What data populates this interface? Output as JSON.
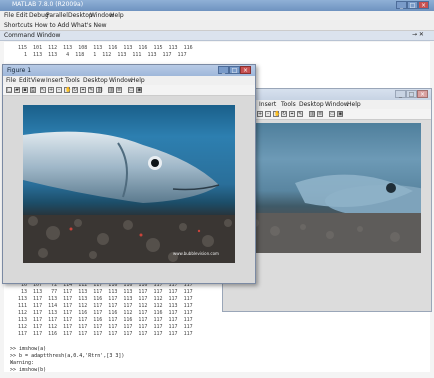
{
  "main": {
    "title": "MATLAB 7.8.0 (R2009a)",
    "menus": [
      "File",
      "Edit",
      "Debug",
      "Parallel",
      "Desktop",
      "Window",
      "Help"
    ],
    "shortcuts": "Shortcuts  How to Add  What's New",
    "command_window_label": "Command Window",
    "top_rows": [
      "115  101  112  113  108  113  116  113  116  115  113  116",
      "  1  113  113   4  118   1  112  113  111  113  117  117"
    ],
    "bottom_rows": [
      " 16  107   72  114  112  117  116  116  116  117  117  117",
      " 13  113   77  117  113  117  113  113  117  117  117  117",
      "113  117  113  117  113  116  117  113  117  112  117  117",
      "111  117  114  117  112  117  117  117  112  112  113  117",
      "112  117  113  117  116  117  116  112  117  116  117  117",
      "113  117  117  117  117  116  117  116  117  117  117  117",
      "112  117  112  117  117  117  117  117  117  117  117  117",
      "117  117  116  117  117  117  117  117  117  117  117  117"
    ],
    "prompt_lines": [
      ">> imshow(a)",
      ">> b = adaptthresh(a,0.4,'Rtrn',[3 3])",
      "Warning:",
      ">> imshow(b)"
    ]
  },
  "fig1": {
    "title": "Figure 1",
    "menus": [
      "File",
      "Edit",
      "View",
      "Insert",
      "Tools",
      "Desktop",
      "Window",
      "Help"
    ],
    "watermark": "www.bubblevision.com"
  },
  "fig2": {
    "menus": [
      "Insert",
      "Tools",
      "Desktop",
      "Window",
      "Help"
    ]
  }
}
